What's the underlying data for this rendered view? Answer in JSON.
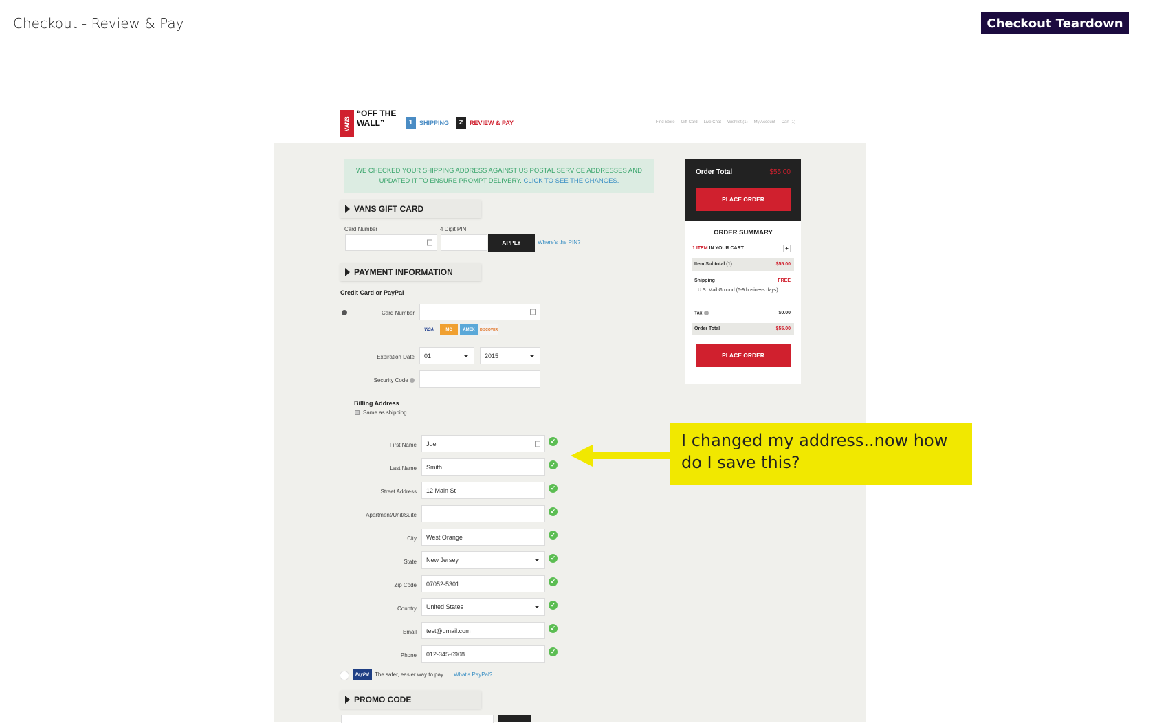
{
  "page": {
    "title": "Checkout - Review & Pay",
    "badge": "Checkout Teardown"
  },
  "site": {
    "logo_box": "VANS",
    "logo_text": "“OFF THE WALL”",
    "steps": [
      {
        "num": "1",
        "label": "SHIPPING",
        "color": "#4a8cc4"
      },
      {
        "num": "2",
        "label": "REVIEW & PAY",
        "color": "#d0202e"
      }
    ],
    "top_links": [
      "Find Store",
      "Gift Card",
      "Live Chat",
      "Wishlist (1)",
      "My Account",
      "Cart (1)"
    ]
  },
  "notice": {
    "text": "WE CHECKED YOUR SHIPPING ADDRESS AGAINST US POSTAL SERVICE ADDRESSES AND UPDATED IT TO ENSURE PROMPT DELIVERY.",
    "link": "CLICK TO SEE THE CHANGES."
  },
  "gift_card": {
    "heading": "VANS GIFT CARD",
    "card_number_label": "Card Number",
    "pin_label": "4 Digit PIN",
    "apply_label": "APPLY",
    "pin_link": "Where's the PIN?"
  },
  "payment": {
    "heading": "PAYMENT INFORMATION",
    "method_label": "Credit Card or PayPal",
    "card_number_label": "Card Number",
    "card_logos": [
      "VISA",
      "MC",
      "AMEX",
      "DISCOVER"
    ],
    "expiration_label": "Expiration Date",
    "exp_month": "01",
    "exp_year": "2015",
    "security_label": "Security Code"
  },
  "billing": {
    "heading": "Billing Address",
    "same_as_shipping": "Same as shipping",
    "fields": [
      {
        "label": "First Name",
        "value": "Joe"
      },
      {
        "label": "Last Name",
        "value": "Smith"
      },
      {
        "label": "Street Address",
        "value": "12 Main St"
      },
      {
        "label": "Apartment/Unit/Suite",
        "value": ""
      },
      {
        "label": "City",
        "value": "West Orange"
      },
      {
        "label": "State",
        "value": "New Jersey"
      },
      {
        "label": "Zip Code",
        "value": "07052-5301"
      },
      {
        "label": "Country",
        "value": "United States"
      },
      {
        "label": "Email",
        "value": "test@gmail.com"
      },
      {
        "label": "Phone",
        "value": "012-345-6908"
      }
    ]
  },
  "paypal": {
    "logo": "PayPal",
    "text": "The safer, easier way to pay.",
    "link": "What's PayPal?"
  },
  "promo": {
    "heading": "PROMO CODE"
  },
  "order": {
    "total_label": "Order Total",
    "total_value": "$55.00",
    "place_order": "PLACE ORDER",
    "summary_heading": "ORDER SUMMARY",
    "items_count": "1 ITEM",
    "items_suffix": "IN YOUR CART",
    "expand": "+",
    "subtotal_label": "Item Subtotal (1)",
    "subtotal_value": "$55.00",
    "shipping_label": "Shipping",
    "shipping_value": "FREE",
    "shipping_method": "U.S. Mail Ground (6-9 business days)",
    "tax_label": "Tax",
    "tax_value": "$0.00",
    "order_total_label": "Order Total",
    "order_total_value": "$55.00"
  },
  "callout": {
    "text": "I changed my address..now how do I save this?",
    "color": "#f1e800"
  }
}
